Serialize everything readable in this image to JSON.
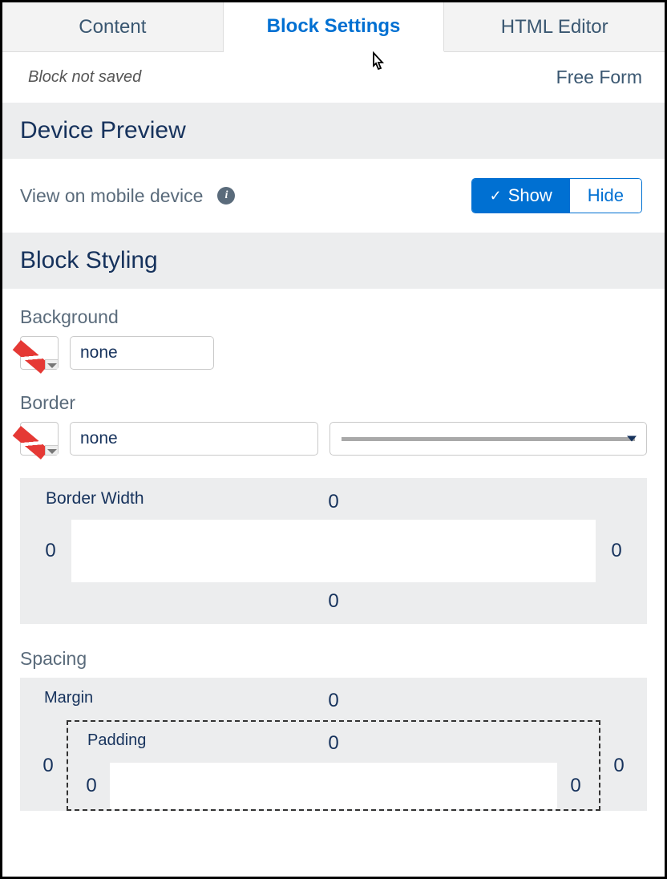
{
  "tabs": {
    "content": "Content",
    "settings": "Block Settings",
    "html": "HTML Editor"
  },
  "status": {
    "left": "Block not saved",
    "right": "Free Form"
  },
  "sections": {
    "preview": "Device Preview",
    "styling": "Block Styling"
  },
  "preview": {
    "label": "View on mobile device",
    "show": "Show",
    "hide": "Hide"
  },
  "styling": {
    "background_label": "Background",
    "background_value": "none",
    "border_label": "Border",
    "border_value": "none",
    "border_width_label": "Border Width",
    "border_width": {
      "top": "0",
      "right": "0",
      "bottom": "0",
      "left": "0"
    },
    "spacing_label": "Spacing",
    "margin_label": "Margin",
    "margin": {
      "top": "0",
      "right": "0",
      "left": "0"
    },
    "padding_label": "Padding",
    "padding": {
      "top": "0",
      "right": "0",
      "left": "0"
    }
  }
}
